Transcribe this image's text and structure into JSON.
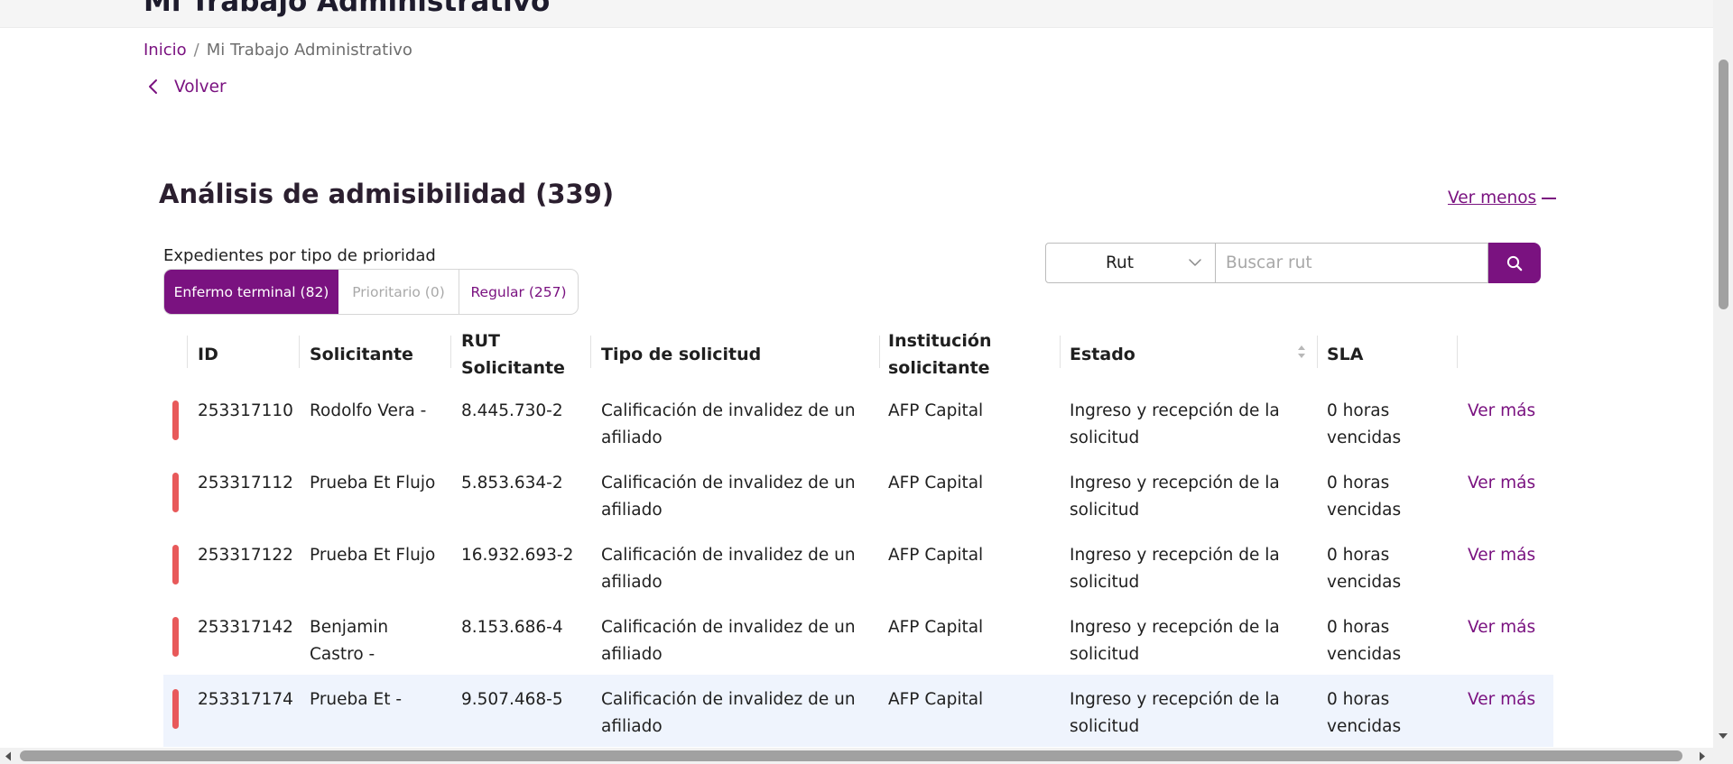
{
  "page": {
    "heading": "Mi Trabajo Administrativo"
  },
  "breadcrumb": {
    "home": "Inicio",
    "separator": "/",
    "current": "Mi Trabajo Administrativo"
  },
  "back": {
    "label": "Volver"
  },
  "section": {
    "title": "Análisis de admisibilidad (339)",
    "toggle_label": "Ver menos"
  },
  "priority": {
    "label": "Expedientes por tipo de prioridad",
    "tabs": [
      {
        "label": "Enfermo terminal (82)",
        "state": "active"
      },
      {
        "label": "Prioritario (0)",
        "state": "disabled"
      },
      {
        "label": "Regular (257)",
        "state": "normal"
      }
    ]
  },
  "search": {
    "field_selected": "Rut",
    "placeholder": "Buscar rut",
    "value": "",
    "button_icon": "search-icon"
  },
  "table": {
    "headers": {
      "id": "ID",
      "solicitante": "Solicitante",
      "rut_line1": "RUT",
      "rut_line2": "Solicitante",
      "tipo": "Tipo de solicitud",
      "institucion_line1": "Institución",
      "institucion_line2": "solicitante",
      "estado": "Estado",
      "sla": "SLA"
    },
    "action_label": "Ver más",
    "rows": [
      {
        "id": "253317110",
        "solicitante": "Rodolfo Vera -",
        "rut": "8.445.730-2",
        "tipo": "Calificación de invalidez de un afiliado",
        "institucion": "AFP Capital",
        "estado": "Ingreso y recepción de la solicitud",
        "sla": "0 horas vencidas",
        "action": "Ver más"
      },
      {
        "id": "253317112",
        "solicitante": "Prueba Et Flujo",
        "rut": "5.853.634-2",
        "tipo": "Calificación de invalidez de un afiliado",
        "institucion": "AFP Capital",
        "estado": "Ingreso y recepción de la solicitud",
        "sla": "0 horas vencidas",
        "action": "Ver más"
      },
      {
        "id": "253317122",
        "solicitante": "Prueba Et Flujo",
        "rut": "16.932.693-2",
        "tipo": "Calificación de invalidez de un afiliado",
        "institucion": "AFP Capital",
        "estado": "Ingreso y recepción de la solicitud",
        "sla": "0 horas vencidas",
        "action": "Ver más"
      },
      {
        "id": "253317142",
        "solicitante": "Benjamin Castro -",
        "rut": "8.153.686-4",
        "tipo": "Calificación de invalidez de un afiliado",
        "institucion": "AFP Capital",
        "estado": "Ingreso y recepción de la solicitud",
        "sla": "0 horas vencidas",
        "action": "Ver más"
      },
      {
        "id": "253317174",
        "solicitante": "Prueba Et -",
        "rut": "9.507.468-5",
        "tipo": "Calificación de invalidez de un afiliado",
        "institucion": "AFP Capital",
        "estado": "Ingreso y recepción de la solicitud",
        "sla": "0 horas vencidas",
        "action": "Ver más"
      }
    ]
  },
  "colors": {
    "brand": "#7a1280",
    "priority_terminal": "#e8595a",
    "row_highlight": "#eff4fd"
  }
}
